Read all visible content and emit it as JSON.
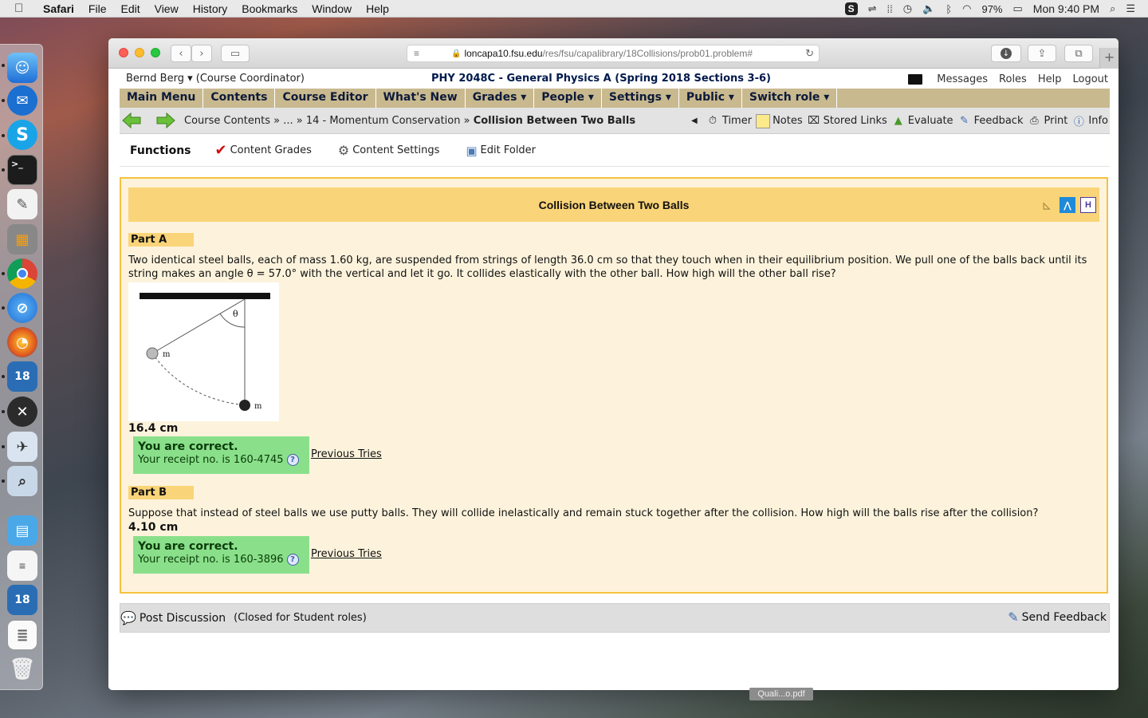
{
  "menubar": {
    "app": "Safari",
    "items": [
      "File",
      "Edit",
      "View",
      "History",
      "Bookmarks",
      "Window",
      "Help"
    ],
    "battery": "97%",
    "clock": "Mon 9:40 PM"
  },
  "browser": {
    "url_host": "loncapa10.fsu.edu",
    "url_path": "/res/fsu/capalibrary/18Collisions/prob01.problem#"
  },
  "userbar": {
    "user": "Bernd Berg ▾",
    "role": "(Course Coordinator)",
    "course": "PHY 2048C - General Physics A (Spring 2018 Sections 3-6)",
    "links": [
      "Messages",
      "Roles",
      "Help",
      "Logout"
    ]
  },
  "mainmenu": [
    "Main Menu",
    "Contents",
    "Course Editor",
    "What's New",
    "Grades ▾",
    "People ▾",
    "Settings ▾",
    "Public ▾",
    "Switch role ▾"
  ],
  "navbar": {
    "crumbs": "Course Contents » ... » 14 - Momentum Conservation »",
    "current": "Collision Between Two Balls",
    "tools": [
      "Timer",
      "Notes",
      "Stored Links",
      "Evaluate",
      "Feedback",
      "Print",
      "Info"
    ]
  },
  "functions": {
    "title": "Functions",
    "items": [
      "Content Grades",
      "Content Settings",
      "Edit Folder"
    ]
  },
  "problem": {
    "title": "Collision Between Two Balls",
    "partA": {
      "label": "Part A",
      "question": "Two identical steel balls, each of mass 1.60 kg, are suspended from strings of length 36.0 cm so that they touch when in their equilibrium position. We pull one of the balls back until its string makes an angle θ = 57.0° with the vertical and let it go. It collides elastically with the other ball. How high will the other ball rise?",
      "answer": "16.4 cm",
      "status": "You are correct.",
      "receipt": "Your receipt no. is 160-4745",
      "prev": "Previous Tries",
      "figure": {
        "theta": "θ",
        "m1": "m",
        "m2": "m"
      }
    },
    "partB": {
      "label": "Part B",
      "question": "Suppose that instead of steel balls we use putty balls. They will collide inelastically and remain stuck together after the collision. How high will the balls rise after the collision?",
      "answer": "4.10 cm",
      "status": "You are correct.",
      "receipt": "Your receipt no. is 160-3896",
      "prev": "Previous Tries"
    }
  },
  "discussion": {
    "post": "Post Discussion",
    "closed": "(Closed for Student roles)",
    "send": "Send Feedback"
  },
  "desktop": {
    "pdf_label": "Quali...o.pdf"
  },
  "colors": {
    "menu_bg": "#c9b98f",
    "problem_border": "#f5c23f",
    "title_bg": "#fad478",
    "correct_bg": "#8ae08a"
  }
}
